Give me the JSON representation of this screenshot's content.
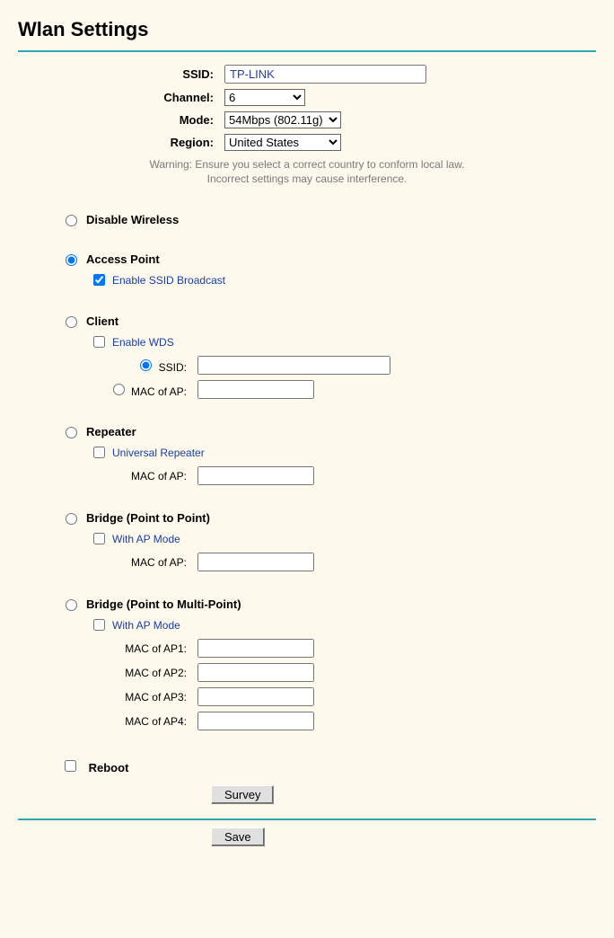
{
  "title": "Wlan Settings",
  "ssid_label": "SSID:",
  "ssid_value": "TP-LINK",
  "channel_label": "Channel:",
  "channel_value": "6",
  "mode_label": "Mode:",
  "mode_value": "54Mbps (802.11g)",
  "region_label": "Region:",
  "region_value": "United States",
  "warning1": "Warning: Ensure you select a correct country to conform local law.",
  "warning2": "Incorrect settings may cause interference.",
  "opt_disable": "Disable Wireless",
  "opt_ap": "Access Point",
  "ap_ssid_broadcast": "Enable SSID Broadcast",
  "opt_client": "Client",
  "client_enable_wds": "Enable WDS",
  "client_ssid_label": "SSID:",
  "client_mac_label": "MAC of AP:",
  "opt_repeater": "Repeater",
  "repeater_universal": "Universal Repeater",
  "repeater_mac_label": "MAC of AP:",
  "opt_bridge_ptp": "Bridge (Point to Point)",
  "ptp_with_ap": "With AP Mode",
  "ptp_mac_label": "MAC of AP:",
  "opt_bridge_ptmp": "Bridge (Point to Multi-Point)",
  "ptmp_with_ap": "With AP Mode",
  "ptmp_mac1": "MAC of AP1:",
  "ptmp_mac2": "MAC of AP2:",
  "ptmp_mac3": "MAC of AP3:",
  "ptmp_mac4": "MAC of AP4:",
  "reboot_label": "Reboot",
  "survey_btn": "Survey",
  "save_btn": "Save"
}
